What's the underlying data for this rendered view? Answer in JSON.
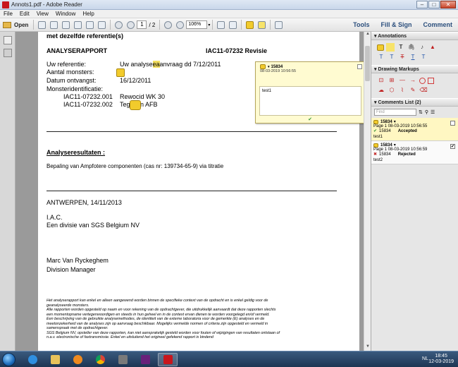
{
  "window": {
    "title": "Annots1.pdf - Adobe Reader"
  },
  "menu": [
    "File",
    "Edit",
    "View",
    "Window",
    "Help"
  ],
  "toolbar": {
    "open_label": "Open",
    "page_current": "1",
    "page_total": "/ 2",
    "zoom": "106%",
    "tabs": [
      "Tools",
      "Fill & Sign",
      "Comment"
    ]
  },
  "document": {
    "top_line": "met dezelfde referentie(s)",
    "report_title": "ANALYSERAPPORT",
    "report_ref": "IAC11-07232 Revisie",
    "fields": [
      {
        "label": "Uw referentie:",
        "value_pre": "Uw analyse",
        "value_hl": "ea",
        "value_post": "anvraag dd 7/12/2011"
      },
      {
        "label": "Aantal monsters:",
        "value_pre": "2",
        "value_hl": "",
        "value_post": ""
      },
      {
        "label": "Datum ontvangst:",
        "value_pre": "16/12/2011",
        "value_hl": "",
        "value_post": ""
      },
      {
        "label": "Monsteridentificatie:",
        "value_pre": "",
        "value_hl": "",
        "value_post": ""
      }
    ],
    "samples": [
      {
        "id": "IAC11-07232.001",
        "name": "Rewocid WK 30"
      },
      {
        "id": "IAC11-07232.002",
        "name": "Tegosan AFB"
      }
    ],
    "results_heading": "Analyseresultaten :",
    "results_text": "Bepaling van Ampfotere componenten (cas nr: 139734-65-9) via titratie",
    "place_date": "ANTWERPEN, 14/11/2013",
    "org1": "I.A.C.",
    "org2": "Een divisie van SGS Belgium NV",
    "signer": "Marc Van Ryckeghem",
    "signer_role": "Division Manager",
    "footer_lines": [
      "Het analyserapport kan enkel en alleen aangewend worden binnen de specifieke context van de opdracht en is enkel geldig voor de",
      "geanalyseerde monsters.",
      "Alle rapporten worden opgesteld op naam en voor rekening van de opdrachtgever, die uitdrukkelijk aanvaardt dat deze rapporten slechts",
      "een momentopname vertegenwoordigen en steeds in hun geheel en in de context ervan dienen te worden voorgelegd en/of vermeld.",
      "Een beschrijving van de gebruikte analysemethodes, de identiteit van de externe laboratoria voor de gemerkte (E) analyses en de",
      "meetonzekerheid van de analyses zijn op aanvraag beschikbaar. Mogelijks vermelde normen of criteria zijn opgesteld en vermeld in",
      "samenspraak met de opdrachtgever.",
      "SGS Belgium NV, opsteller van deze rapporten, kan niet aansprakelijk gesteld worden voor fouten of wijzigingen van resultaten ontstaan of",
      "n.a.v. electronische of faxtransmissie. Enkel en uitsluitend het origineel gefekend rapport is bindend"
    ]
  },
  "popup": {
    "author": "15834",
    "date": "08-03-2019 10:56:55",
    "text": "test1",
    "ok_glyph": "✔"
  },
  "panel": {
    "annotations_title": "Annotations",
    "drawing_title": "Drawing Markups",
    "comments_title": "Comments List (2)",
    "find_placeholder": "Find",
    "comments": [
      {
        "author": "15834",
        "page_line": "Page 1  08-03-2019 10:56:55",
        "status_author": "15834",
        "status": "Accepted",
        "text": "test1",
        "checked": ""
      },
      {
        "author": "15834",
        "page_line": "Page 1  08-03-2019 10:56:59",
        "status_author": "15834",
        "status": "Rejected",
        "text": "test2",
        "checked": "✔"
      }
    ]
  },
  "taskbar": {
    "time": "18:45",
    "date": "12-03-2019",
    "lang": "NL"
  }
}
